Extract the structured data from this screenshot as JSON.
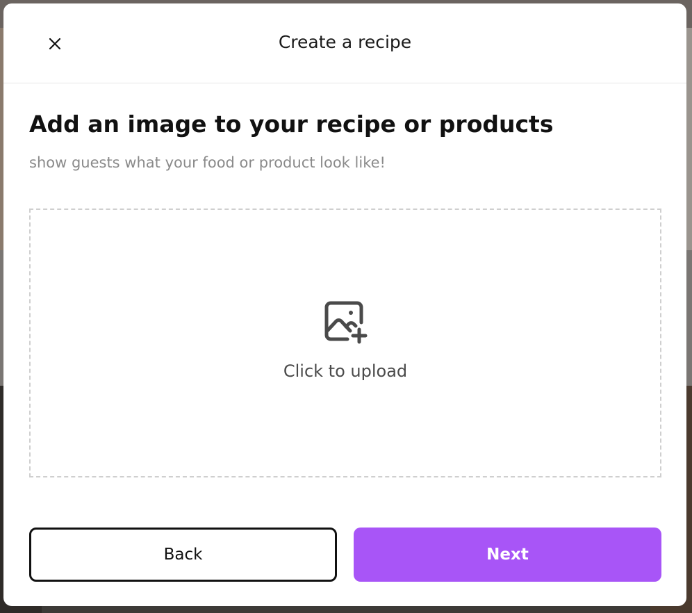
{
  "modal": {
    "title": "Create a recipe",
    "heading": "Add an image to your recipe or products",
    "subheading": "show guests what your food or product look like!",
    "upload": {
      "icon": "image-plus-icon",
      "label": "Click to upload"
    },
    "buttons": {
      "back_label": "Back",
      "next_label": "Next"
    }
  },
  "colors": {
    "accent": "#a855f7",
    "text": "#111111",
    "muted": "#8a8a8a",
    "dropzone_border": "#cfcfcf"
  }
}
